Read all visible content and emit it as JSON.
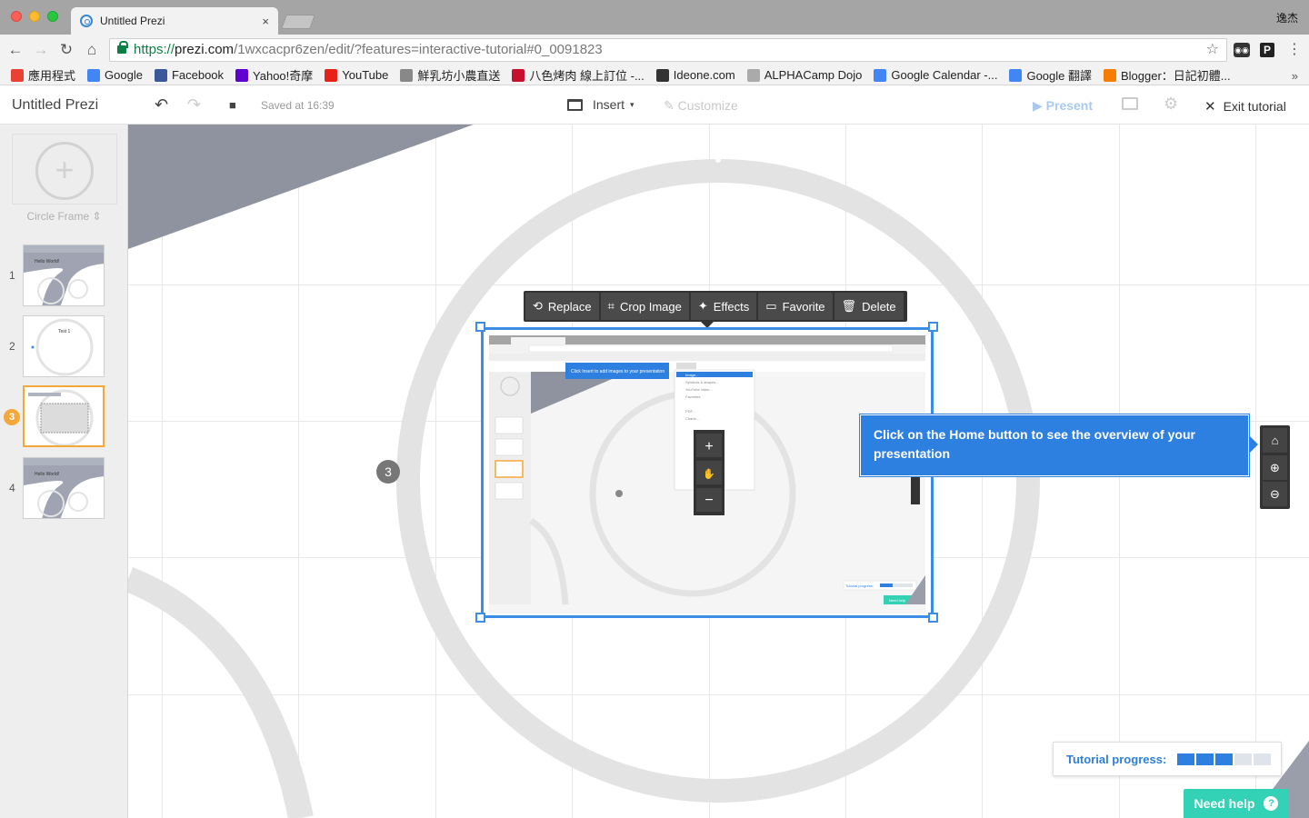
{
  "browser": {
    "tab_title": "Untitled Prezi",
    "tab_close": "×",
    "profile_name": "逸杰",
    "url_https": "https://",
    "url_host": "prezi.com",
    "url_path": "/1wxcacpr6zen/edit/?features=interactive-tutorial#0_0091823",
    "nav_back": "←",
    "nav_forward": "→",
    "nav_reload": "↻",
    "nav_home": "⌂",
    "star": "☆",
    "ext_p": "P",
    "ext_menu": "⋮",
    "bookmarks_more": "»",
    "bookmarks": [
      {
        "label": "應用程式",
        "icon": "apps-grid-icon",
        "color": "#e94235"
      },
      {
        "label": "Google",
        "icon": "google-icon",
        "color": "#4285f4"
      },
      {
        "label": "Facebook",
        "icon": "facebook-icon",
        "color": "#3b5998"
      },
      {
        "label": "Yahoo!奇摩",
        "icon": "yahoo-icon",
        "color": "#5f01d1"
      },
      {
        "label": "YouTube",
        "icon": "youtube-icon",
        "color": "#e62117"
      },
      {
        "label": "鮮乳坊小農直送",
        "icon": "cloud-icon",
        "color": "#888888"
      },
      {
        "label": "八色烤肉 線上訂位 -...",
        "icon": "restaurant-icon",
        "color": "#c8102e"
      },
      {
        "label": "Ideone.com",
        "icon": "ideone-icon",
        "color": "#333333"
      },
      {
        "label": "ALPHACamp Dojo",
        "icon": "page-icon",
        "color": "#aaaaaa"
      },
      {
        "label": "Google Calendar -...",
        "icon": "calendar-icon",
        "color": "#4285f4"
      },
      {
        "label": "Google 翻譯",
        "icon": "translate-icon",
        "color": "#4285f4"
      },
      {
        "label": "Blogger：日記初體...",
        "icon": "blogger-icon",
        "color": "#f57d00"
      }
    ]
  },
  "app": {
    "doc_title": "Untitled Prezi",
    "undo": "↶",
    "redo": "↷",
    "save_icon": "■",
    "saved_text": "Saved at 16:39",
    "insert_label": "Insert",
    "insert_caret": "▾",
    "customize_label": "Customize",
    "present_label": "Present",
    "exit_label": "Exit tutorial",
    "exit_x": "✕"
  },
  "sidebar": {
    "frame_plus": "+",
    "frame_label": "Circle Frame ⇕",
    "slides": [
      {
        "num": "1",
        "caption": "Hello World!"
      },
      {
        "num": "2",
        "caption": "Test 1"
      },
      {
        "num": "3",
        "caption": ""
      },
      {
        "num": "4",
        "caption": "Hello World!"
      }
    ],
    "active_badge": "3"
  },
  "canvas": {
    "path_number": "3",
    "image_toolbar": [
      {
        "label": "Replace",
        "icon": "replace-icon",
        "glyph": "⟲"
      },
      {
        "label": "Crop Image",
        "icon": "crop-icon",
        "glyph": "⌗"
      },
      {
        "label": "Effects",
        "icon": "effects-icon",
        "glyph": "✦"
      },
      {
        "label": "Favorite",
        "icon": "favorite-icon",
        "glyph": "▭"
      },
      {
        "label": "Delete",
        "icon": "trash-icon",
        "glyph": "🗑"
      }
    ],
    "embedded_screenshot": {
      "insert_hint": "Click Insert to add images to your presentation",
      "menu_items": [
        "Image...",
        "Symbols & shapes...",
        "YouTube video...",
        "Favorites",
        "PDF...",
        "Charts...",
        "Layouts..."
      ],
      "progress_label": "Tutorial progress:",
      "help_label": "Need help"
    },
    "tooltip": "Click on the Home button to see the overview of your presentation",
    "zoom": {
      "home": "⌂",
      "zoom_in": "⊕",
      "zoom_out": "⊖"
    },
    "progress_label": "Tutorial progress:",
    "progress_steps_done": 3,
    "progress_steps_total": 5,
    "help_label": "Need help",
    "help_q": "?"
  },
  "colors": {
    "accent_blue": "#2d7fe0",
    "selection_blue": "#3b8de5",
    "active_orange": "#f3a839",
    "help_teal": "#33d1b5",
    "wedge_gray": "#8f93a0",
    "circle_gray": "#e3e3e3"
  }
}
